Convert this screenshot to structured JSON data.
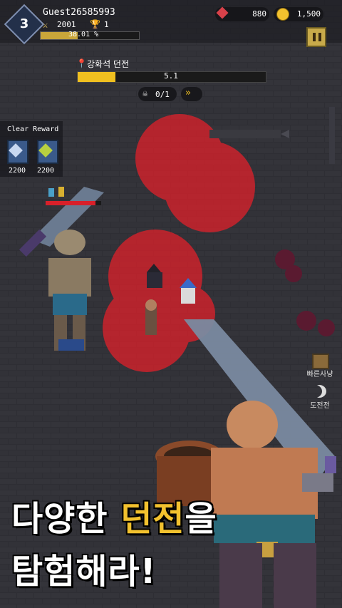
{
  "hud": {
    "level": "3",
    "player_name": "Guest26585993",
    "power_icon": "crossed-swords-icon",
    "power": "2001",
    "trophy_icon": "trophy-icon",
    "trophies": "1",
    "xp_text": "38.01 %",
    "xp_progress": 0.3801,
    "gems": "880",
    "gold": "1,500",
    "pause_icon": "pause-icon"
  },
  "dungeon": {
    "name": "강화석 던전",
    "stage": "5.1",
    "stage_progress": 0.2,
    "kills": "0/1",
    "fast_forward_icon": "fast-forward-icon"
  },
  "reward": {
    "title": "Clear Reward",
    "items": [
      {
        "icon": "white-crystal-icon",
        "qty": "2200"
      },
      {
        "icon": "green-crystal-icon",
        "qty": "2200"
      }
    ]
  },
  "side_buttons": [
    {
      "icon": "chest-icon",
      "label": "빠른사냥"
    },
    {
      "icon": "moon-icon",
      "label": "도전전"
    }
  ],
  "headline": {
    "line1_pre": "다양한 ",
    "line1_highlight": "던전",
    "line1_post": "을",
    "line2": "탐험해라!"
  },
  "colors": {
    "accent_yellow": "#f2c12e",
    "danger_red": "#e0202a",
    "gem_red": "#d8414a"
  }
}
